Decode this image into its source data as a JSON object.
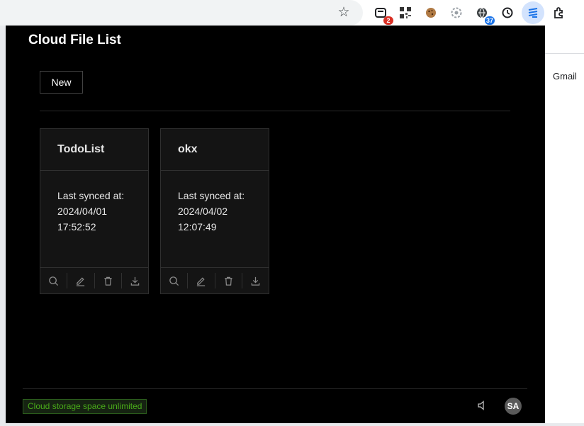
{
  "browser": {
    "extensions": [
      {
        "name": "extension-tab-icon",
        "badge": "2",
        "badge_color": "#d93025"
      },
      {
        "name": "qr-code-icon"
      },
      {
        "name": "cookie-icon"
      },
      {
        "name": "gear-extension-icon"
      },
      {
        "name": "globe-extension-icon",
        "badge": "37",
        "badge_color": "#1a73e8"
      },
      {
        "name": "clock-icon"
      },
      {
        "name": "cloud-sync-extension-icon",
        "active": true
      },
      {
        "name": "puzzle-icon"
      }
    ]
  },
  "background_page": {
    "gmail": "Gmail"
  },
  "popup": {
    "title": "Cloud File List",
    "new_label": "New",
    "files": [
      {
        "name": "TodoList",
        "synced_label": "Last synced at:",
        "date": "2024/04/01",
        "time": "17:52:52"
      },
      {
        "name": "okx",
        "synced_label": "Last synced at:",
        "date": "2024/04/02",
        "time": "12:07:49"
      }
    ],
    "actions": [
      "search-icon",
      "edit-icon",
      "delete-icon",
      "download-icon"
    ],
    "storage_label": "Cloud storage space unlimited",
    "avatar_initials": "SA"
  },
  "colors": {
    "popup_bg": "#000000",
    "card_bg": "#141414",
    "storage_green": "#49aa19",
    "active_ext_bg": "#d3e3fd"
  }
}
